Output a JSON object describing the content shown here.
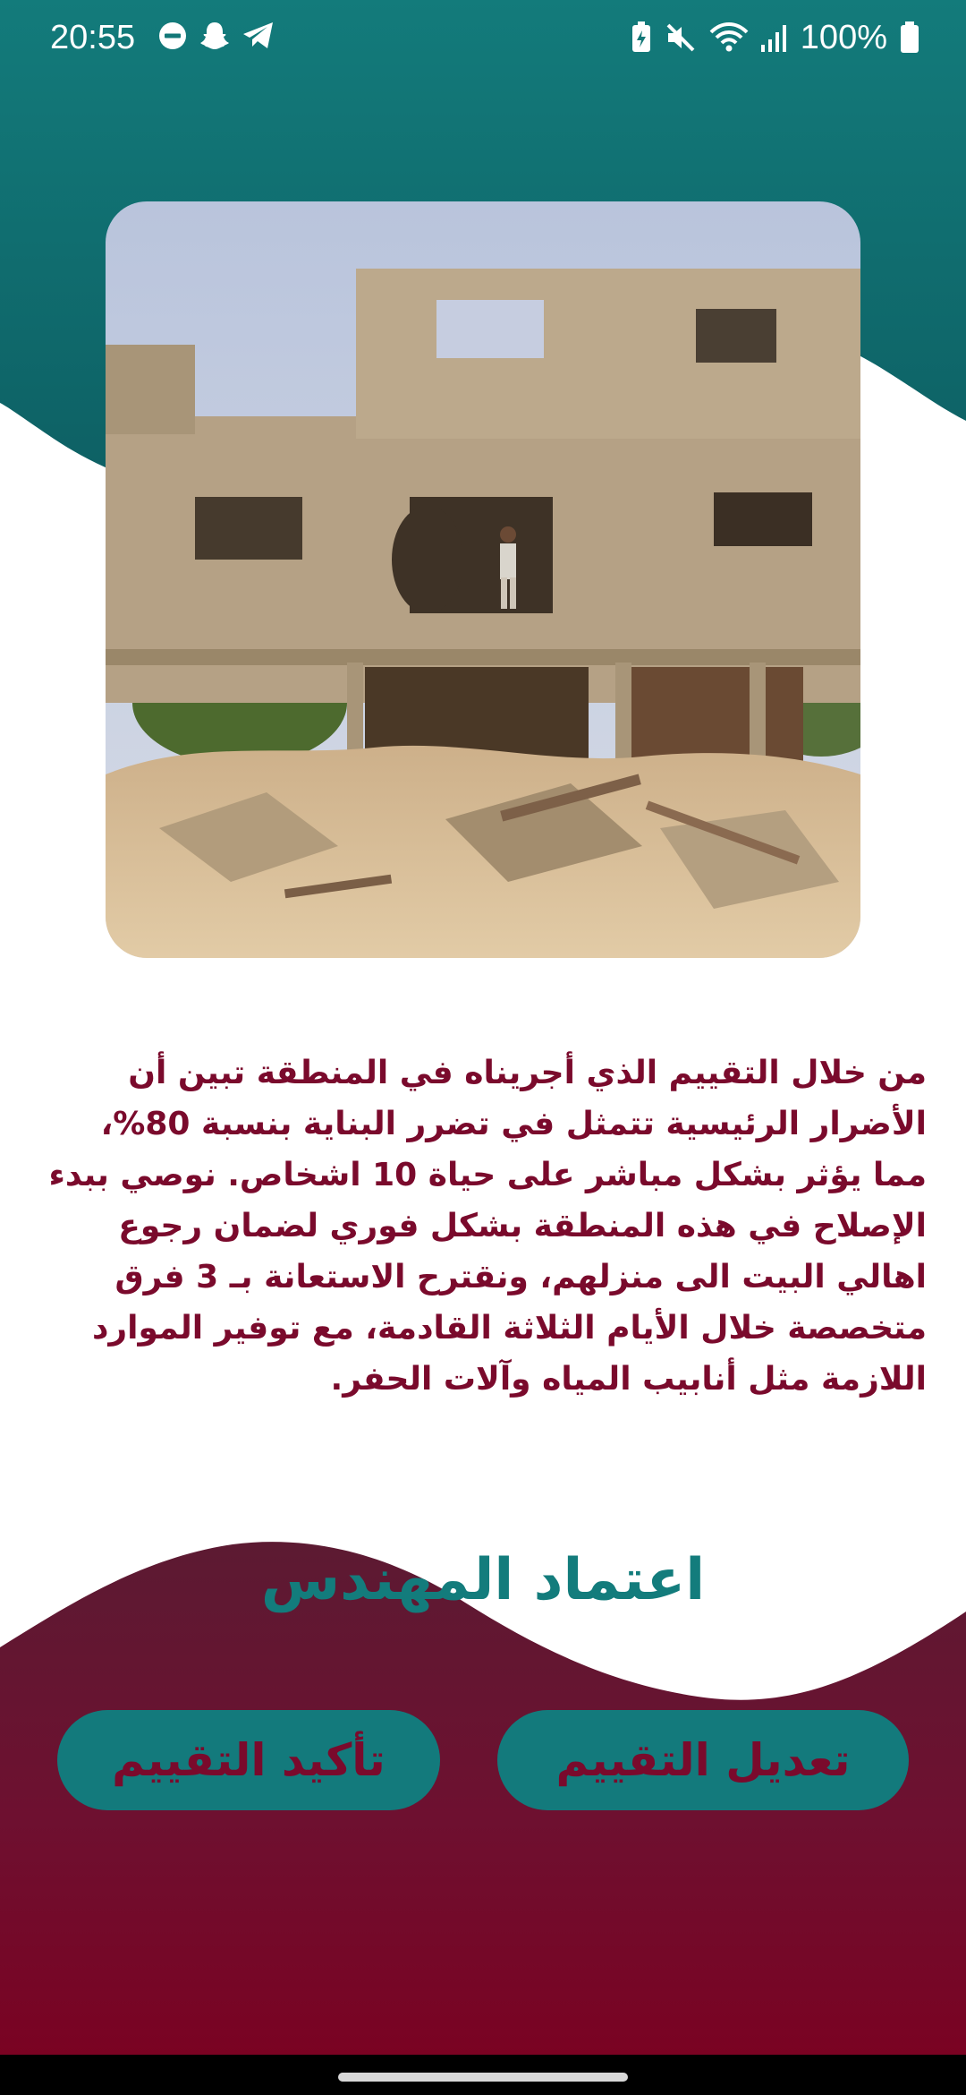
{
  "status_bar": {
    "time": "20:55",
    "battery": "100%",
    "icons_left": [
      "do-not-disturb-icon",
      "snapchat-icon",
      "telegram-icon"
    ],
    "icons_right": [
      "battery-saver-icon",
      "mute-icon",
      "wifi-icon",
      "signal-icon",
      "battery-icon"
    ]
  },
  "photo": {
    "subject": "damaged-building-photo"
  },
  "report": {
    "text": "من خلال التقييم الذي أجريناه في المنطقة  تبين أن الأضرار الرئيسية تتمثل في تضرر البناية بنسبة 80%، مما يؤثر بشكل مباشر على حياة 10 اشخاص. نوصي ببدء الإصلاح في هذه المنطقة بشكل فوري لضمان رجوع اهالي البيت الى منزلهم، ونقترح الاستعانة بـ 3 فرق متخصصة خلال الأيام الثلاثة القادمة، مع توفير الموارد اللازمة مثل أنابيب المياه وآلات الحفر."
  },
  "approval": {
    "title": "اعتماد المهندس"
  },
  "buttons": {
    "confirm_label": "تأكيد التقييم",
    "edit_label": "تعديل التقييم"
  },
  "colors": {
    "teal": "#137c7c",
    "maroon": "#7a0a2c",
    "background": "#ffffff"
  }
}
